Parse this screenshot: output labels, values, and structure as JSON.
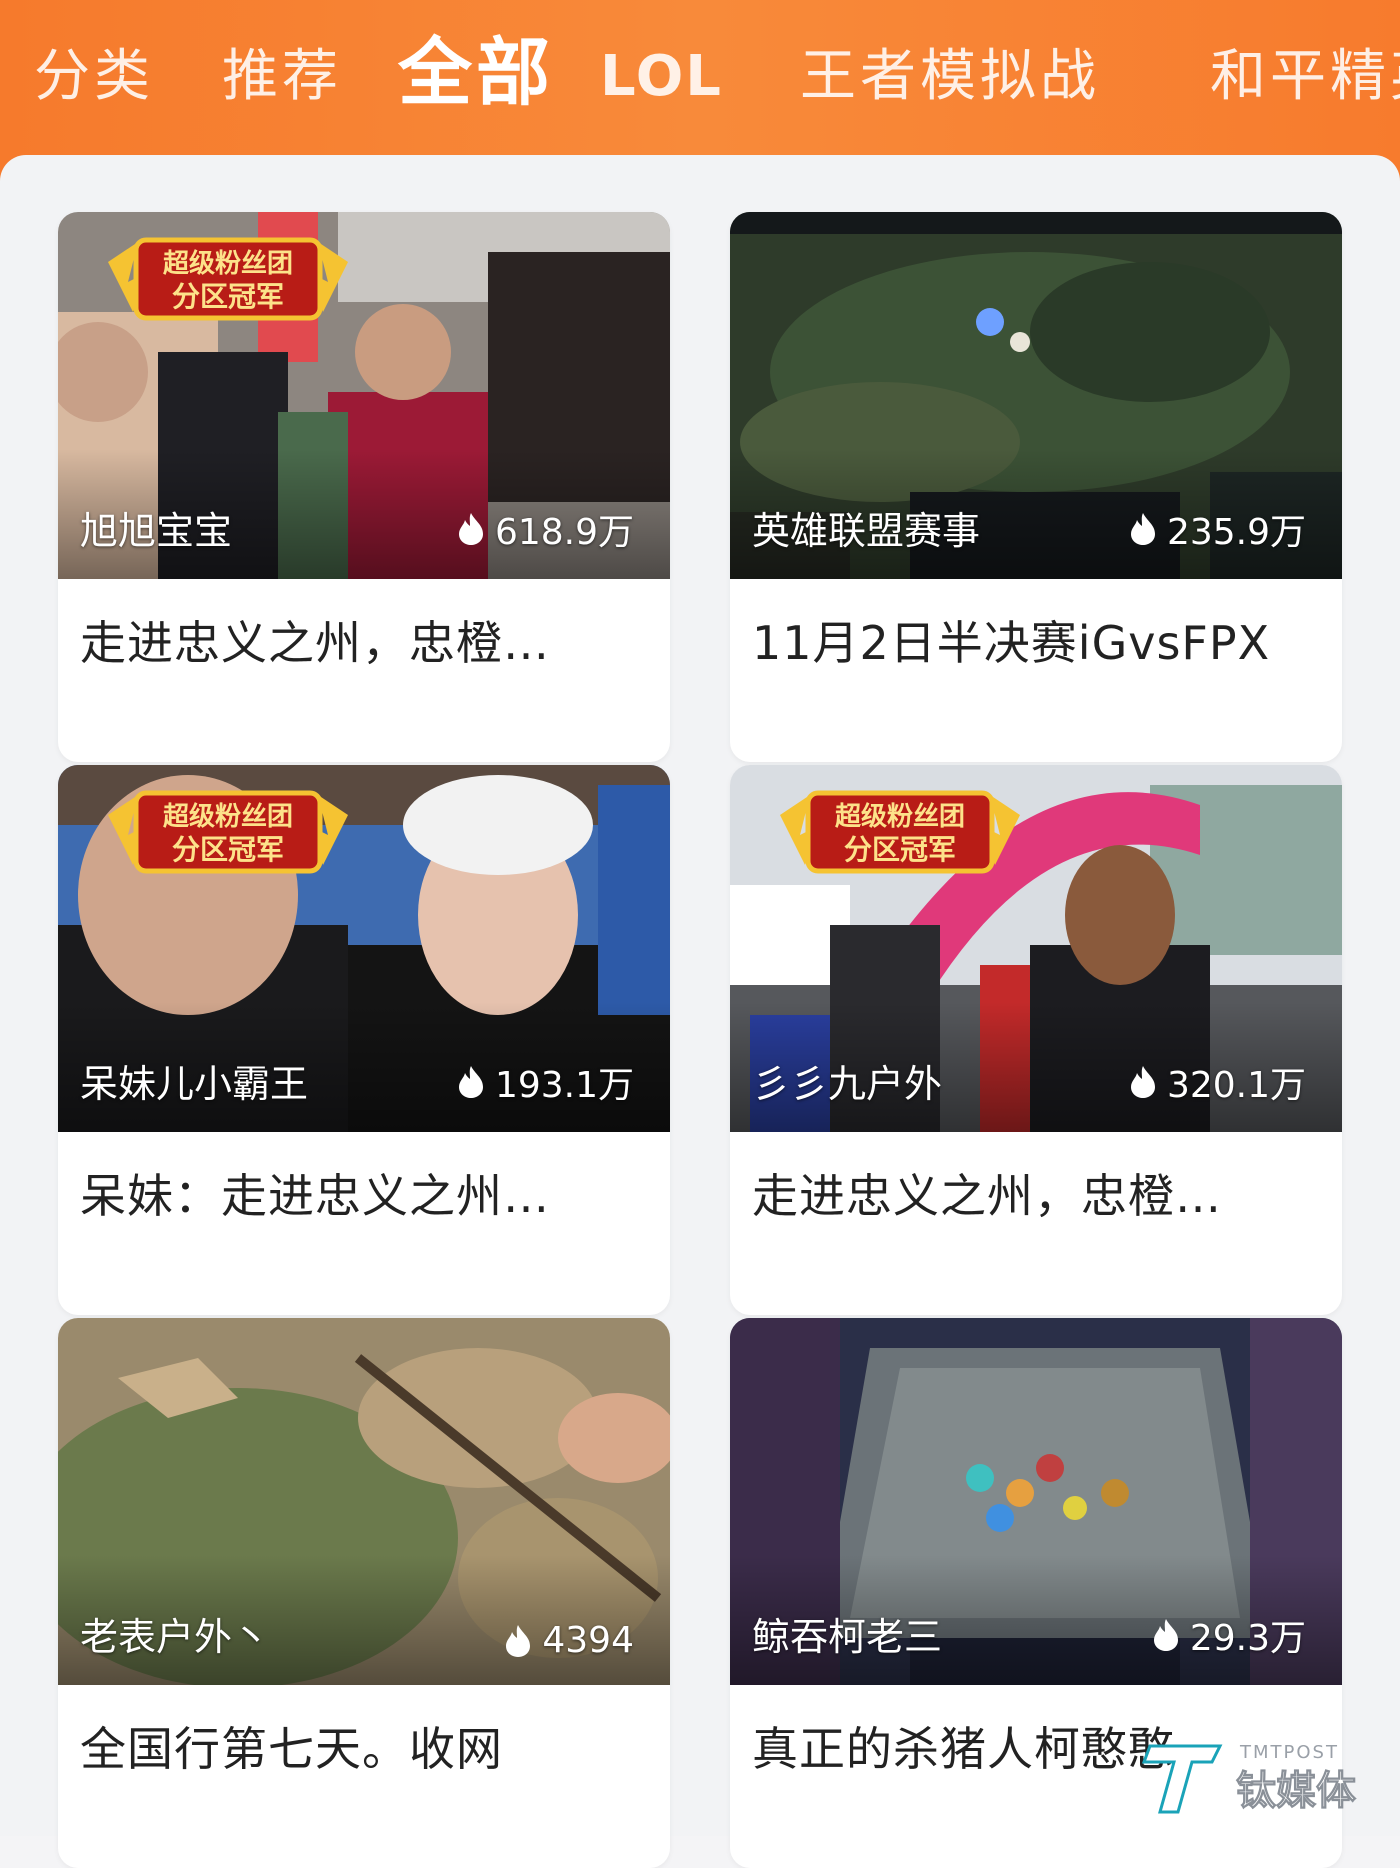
{
  "tabs": [
    {
      "label": "分类"
    },
    {
      "label": "推荐"
    },
    {
      "label": "全部"
    },
    {
      "label": "LOL"
    },
    {
      "label": "王者模拟战"
    },
    {
      "label": "和平精英"
    }
  ],
  "badge_text": {
    "line1": "超级粉丝团",
    "line2": "分区冠军"
  },
  "cards": [
    {
      "streamer": "旭旭宝宝",
      "heat": "618.9万",
      "title": "走进忠义之州，忠橙…"
    },
    {
      "streamer": "英雄联盟赛事",
      "heat": "235.9万",
      "title": "11月2日半决赛iGvsFPX"
    },
    {
      "streamer": "呆妹儿小霸王",
      "heat": "193.1万",
      "title": "呆妹：走进忠义之州…"
    },
    {
      "streamer": "彡彡九户外",
      "heat": "320.1万",
      "title": "走进忠义之州，忠橙…"
    },
    {
      "streamer": "老表户外丶",
      "heat": "4394",
      "title": "全国行第七天。收网"
    },
    {
      "streamer": "鲸吞柯老三",
      "heat": "29.3万",
      "title": "真正的杀猪人柯憨憨"
    }
  ],
  "watermark": {
    "en": "TMTPOST",
    "cn": "钛媒体"
  },
  "colors": {
    "accent": "#f77b2d",
    "badge_red": "#b81c16",
    "badge_gold": "#f5c332"
  }
}
